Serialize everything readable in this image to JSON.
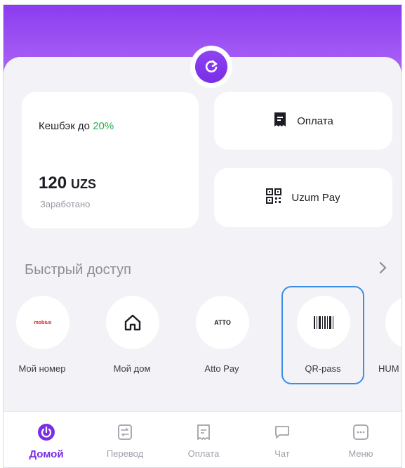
{
  "header": {
    "refresh_icon": "refresh-icon",
    "accent_color": "#7a2ee6"
  },
  "cashback": {
    "title_prefix": "Кешбэк до ",
    "percent": "20%",
    "amount": "120",
    "currency": "UZS",
    "caption": "Заработано"
  },
  "actions": {
    "payment_label": "Оплата",
    "payment_icon": "receipt-icon",
    "uzum_pay_label": "Uzum Pay",
    "uzum_pay_icon": "qr-code-icon"
  },
  "quick_access": {
    "title": "Быстрый доступ",
    "items": [
      {
        "label": "Мой номер",
        "icon": "mobius-logo",
        "logo_text": "mobius"
      },
      {
        "label": "Мой дом",
        "icon": "home-icon"
      },
      {
        "label": "Atto Pay",
        "icon": "atto-logo",
        "logo_text": "ATTO"
      },
      {
        "label": "QR-pass",
        "icon": "barcode-icon",
        "selected": true
      },
      {
        "label": "HUM",
        "icon": "hum-icon"
      }
    ]
  },
  "bottom_nav": {
    "items": [
      {
        "label": "Домой",
        "icon": "home-power-icon",
        "active": true
      },
      {
        "label": "Перевод",
        "icon": "transfer-icon"
      },
      {
        "label": "Оплата",
        "icon": "payment-icon"
      },
      {
        "label": "Чат",
        "icon": "chat-icon"
      },
      {
        "label": "Меню",
        "icon": "menu-icon"
      }
    ]
  }
}
